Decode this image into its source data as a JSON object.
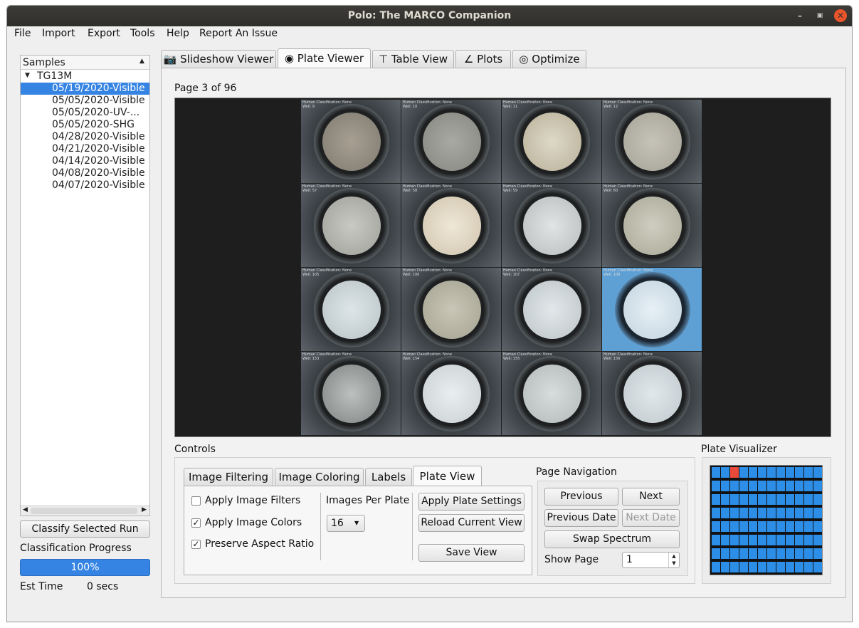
{
  "window": {
    "title": "Polo: The MARCO Companion"
  },
  "menu": [
    "File",
    "Import",
    "Export",
    "Tools",
    "Help",
    "Report An Issue"
  ],
  "sidebar": {
    "header": "Samples",
    "root": "TG13M",
    "items": [
      "05/19/2020-Visible",
      "05/05/2020-Visible",
      "05/05/2020-UV-...",
      "05/05/2020-SHG",
      "04/28/2020-Visible",
      "04/21/2020-Visible",
      "04/14/2020-Visible",
      "04/08/2020-Visible",
      "04/07/2020-Visible"
    ],
    "selected_index": 0,
    "classify_button": "Classify Selected Run",
    "progress_label": "Classification Progress",
    "progress_value": 1.0,
    "progress_text": "100%",
    "est_time_label": "Est Time",
    "est_time_value": "0 secs"
  },
  "tabs": [
    {
      "label": "Slideshow Viewer",
      "icon": "camera-icon"
    },
    {
      "label": "Plate Viewer",
      "icon": "eye-icon",
      "selected": true
    },
    {
      "label": "Table View",
      "icon": "table-icon"
    },
    {
      "label": "Plots",
      "icon": "chart-icon"
    },
    {
      "label": "Optimize",
      "icon": "target-icon"
    }
  ],
  "viewer": {
    "page_label": "Page 3 of 96",
    "wells": [
      {
        "label": "Human Classification: None\nWell: 9"
      },
      {
        "label": "Human Classification: None\nWell: 10"
      },
      {
        "label": "Human Classification: None\nWell: 11"
      },
      {
        "label": "Human Classification: None\nWell: 12"
      },
      {
        "label": "Human Classification: None\nWell: 57"
      },
      {
        "label": "Human Classification: None\nWell: 58"
      },
      {
        "label": "Human Classification: None\nWell: 59"
      },
      {
        "label": "Human Classification: None\nWell: 60"
      },
      {
        "label": "Human Classification: None\nWell: 105"
      },
      {
        "label": "Human Classification: None\nWell: 106"
      },
      {
        "label": "Human Classification: None\nWell: 107"
      },
      {
        "label": "Human Classification: None\nWell: 108"
      },
      {
        "label": "Human Classification: None\nWell: 153"
      },
      {
        "label": "Human Classification: None\nWell: 154"
      },
      {
        "label": "Human Classification: None\nWell: 155"
      },
      {
        "label": "Human Classification: None\nWell: 156"
      }
    ],
    "selected_well_index": 11
  },
  "controls": {
    "title": "Controls",
    "tabs": [
      "Image Filtering",
      "Image Coloring",
      "Labels",
      "Plate View"
    ],
    "selected_tab": "Plate View",
    "apply_filters": {
      "label": "Apply Image Filters",
      "checked": false
    },
    "apply_colors": {
      "label": "Apply Image Colors",
      "checked": true
    },
    "preserve_aspect": {
      "label": "Preserve Aspect Ratio",
      "checked": true
    },
    "images_per_plate_label": "Images Per Plate",
    "images_per_plate_value": "16",
    "apply_plate_settings": "Apply Plate Settings",
    "reload_current_view": "Reload Current View",
    "save_view": "Save View"
  },
  "navigation": {
    "title": "Page Navigation",
    "previous": "Previous",
    "next": "Next",
    "previous_date": "Previous Date",
    "next_date": "Next Date",
    "swap_spectrum": "Swap Spectrum",
    "show_page_label": "Show Page",
    "show_page_value": "1"
  },
  "plate_visualizer": {
    "title": "Plate Visualizer",
    "highlight": {
      "row": 0,
      "col": 2
    },
    "colors": {
      "cell": "#2d8ee8",
      "highlight": "#e84a3a"
    }
  }
}
